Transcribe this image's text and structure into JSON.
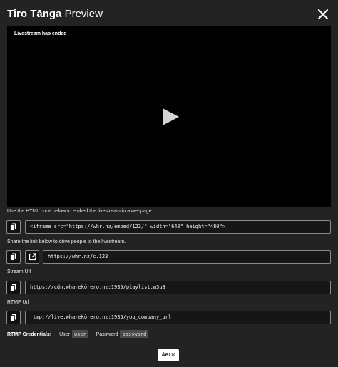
{
  "dialog": {
    "title_bold": "Tiro Tānga",
    "title_rest": " Preview",
    "close_icon": "close-icon"
  },
  "video": {
    "status": "Livestream has ended",
    "play_icon": "play-icon"
  },
  "embed": {
    "label": "Use the HTML code below to embed the livestream in a webpage.",
    "value": "<iframe src=\"https://whr.nz/embed/123/\" width=\"640\" height=\"480\">"
  },
  "share": {
    "label": "Share the link below to drive people to the livestream.",
    "value": "https://whr.nz/c.123"
  },
  "stream": {
    "label": "Stream Url",
    "value": "https://cdn.wharekōrero.nz:1935/playlist.m3u8"
  },
  "rtmp": {
    "label": "RTMP Url",
    "value": "rtmp://live.wharekōrero.nz:1935/you_company_url"
  },
  "credentials": {
    "heading": "RTMP Credentials:",
    "user_label": "User",
    "user_value": "user",
    "password_label": "Password",
    "password_value": "password"
  },
  "ok_button": {
    "prefix": "Āe",
    "label": "Ok"
  },
  "icons": {
    "copy": "copy-icon",
    "external": "external-link-icon"
  },
  "colors": {
    "background": "#232323",
    "video": "#000000",
    "field_border": "#8a8a8a",
    "badge": "#4a4a4a"
  }
}
